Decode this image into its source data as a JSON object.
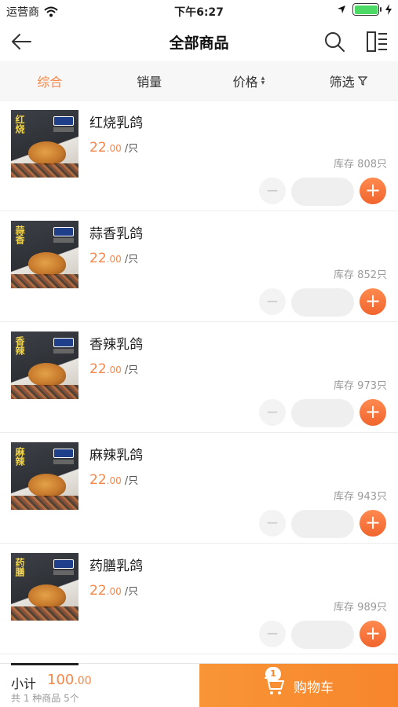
{
  "status_bar": {
    "carrier": "运营商",
    "time": "下午6:27",
    "battery_level": 1.0
  },
  "nav": {
    "title": "全部商品",
    "back_icon": "arrow-left-icon",
    "search_icon": "search-icon",
    "layout_icon": "list-layout-icon"
  },
  "filters": {
    "items": [
      {
        "label": "综合",
        "active": true
      },
      {
        "label": "销量",
        "active": false
      },
      {
        "label": "价格",
        "active": false
      },
      {
        "label": "筛选",
        "active": false
      }
    ]
  },
  "products": [
    {
      "name": "红烧乳鸽",
      "thumb_text": "红烧",
      "price_int": "22",
      "price_cents": ".00",
      "unit": "/只",
      "stock": "库存 808只"
    },
    {
      "name": "蒜香乳鸽",
      "thumb_text": "蒜香",
      "price_int": "22",
      "price_cents": ".00",
      "unit": "/只",
      "stock": "库存 852只"
    },
    {
      "name": "香辣乳鸽",
      "thumb_text": "香辣",
      "price_int": "22",
      "price_cents": ".00",
      "unit": "/只",
      "stock": "库存 973只"
    },
    {
      "name": "麻辣乳鸽",
      "thumb_text": "麻辣",
      "price_int": "22",
      "price_cents": ".00",
      "unit": "/只",
      "stock": "库存 943只"
    },
    {
      "name": "药膳乳鸽",
      "thumb_text": "药膳",
      "price_int": "22",
      "price_cents": ".00",
      "unit": "/只",
      "stock": "库存 989只"
    }
  ],
  "bottom": {
    "subtotal_label": "小计",
    "subtotal_int": "100",
    "subtotal_cents": ".00",
    "summary": "共 1 种商品 5个",
    "cart_label": "购物车",
    "cart_count": "1"
  },
  "colors": {
    "accent": "#f6874a",
    "cart_button": "#f7852c"
  }
}
